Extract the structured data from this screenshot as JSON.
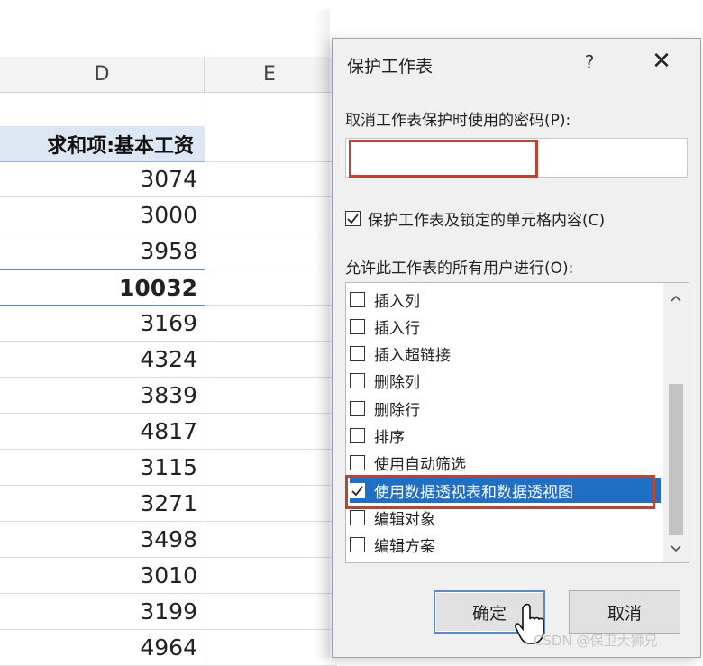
{
  "sheet": {
    "columns": [
      "D",
      "E"
    ],
    "header_cell": "求和项:基本工资",
    "rows": [
      {
        "value": "3074",
        "bold": false
      },
      {
        "value": "3000",
        "bold": false
      },
      {
        "value": "3958",
        "bold": false
      },
      {
        "value": "10032",
        "bold": true
      },
      {
        "value": "3169",
        "bold": false
      },
      {
        "value": "4324",
        "bold": false
      },
      {
        "value": "3839",
        "bold": false
      },
      {
        "value": "4817",
        "bold": false
      },
      {
        "value": "3115",
        "bold": false
      },
      {
        "value": "3271",
        "bold": false
      },
      {
        "value": "3498",
        "bold": false
      },
      {
        "value": "3010",
        "bold": false
      },
      {
        "value": "3199",
        "bold": false
      },
      {
        "value": "4964",
        "bold": false
      }
    ]
  },
  "dialog": {
    "title": "保护工作表",
    "help": "?",
    "close": "✕",
    "password_label": "取消工作表保护时使用的密码(P):",
    "password_value": "",
    "protect_label": "保护工作表及锁定的单元格内容(C)",
    "protect_checked": true,
    "allow_label": "允许此工作表的所有用户进行(O):",
    "permissions": [
      {
        "label": "插入列",
        "checked": false
      },
      {
        "label": "插入行",
        "checked": false
      },
      {
        "label": "插入超链接",
        "checked": false
      },
      {
        "label": "删除列",
        "checked": false
      },
      {
        "label": "删除行",
        "checked": false
      },
      {
        "label": "排序",
        "checked": false
      },
      {
        "label": "使用自动筛选",
        "checked": false
      },
      {
        "label": "使用数据透视表和数据透视图",
        "checked": true,
        "selected": true
      },
      {
        "label": "编辑对象",
        "checked": false
      },
      {
        "label": "编辑方案",
        "checked": false
      }
    ],
    "ok_label": "确定",
    "cancel_label": "取消"
  },
  "watermark": "CSDN @保卫大狮兄",
  "colors": {
    "header_fill": "#dde7f4",
    "selection": "#1f6fc5",
    "highlight": "#b5473a"
  }
}
